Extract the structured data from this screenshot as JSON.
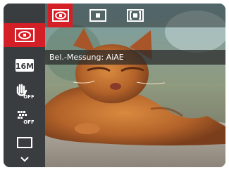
{
  "menu": {
    "items": [
      {
        "name": "metering",
        "icon": "metering-multi-icon",
        "active": true
      },
      {
        "name": "image-size",
        "icon": "image-size-16m-icon",
        "text": "16M",
        "active": false
      },
      {
        "name": "stabilizer",
        "icon": "stabilizer-off-icon",
        "text": "OFF",
        "active": false
      },
      {
        "name": "continuous-shot",
        "icon": "continuous-shot-off-icon",
        "text": "OFF",
        "active": false
      },
      {
        "name": "frame",
        "icon": "frame-rectangle-icon",
        "active": false
      },
      {
        "name": "more",
        "icon": "chevron-down-icon",
        "active": false
      }
    ]
  },
  "submenu": {
    "options": [
      {
        "name": "multi-metering",
        "icon": "metering-multi-icon",
        "active": true
      },
      {
        "name": "spot-metering",
        "icon": "metering-spot-icon",
        "active": false
      },
      {
        "name": "center-weighted",
        "icon": "metering-center-icon",
        "active": false
      }
    ]
  },
  "label": {
    "text": "Bel.-Messung: AiAE"
  },
  "colors": {
    "accent": "#d51f26",
    "sidebar": "#3a3d40"
  }
}
